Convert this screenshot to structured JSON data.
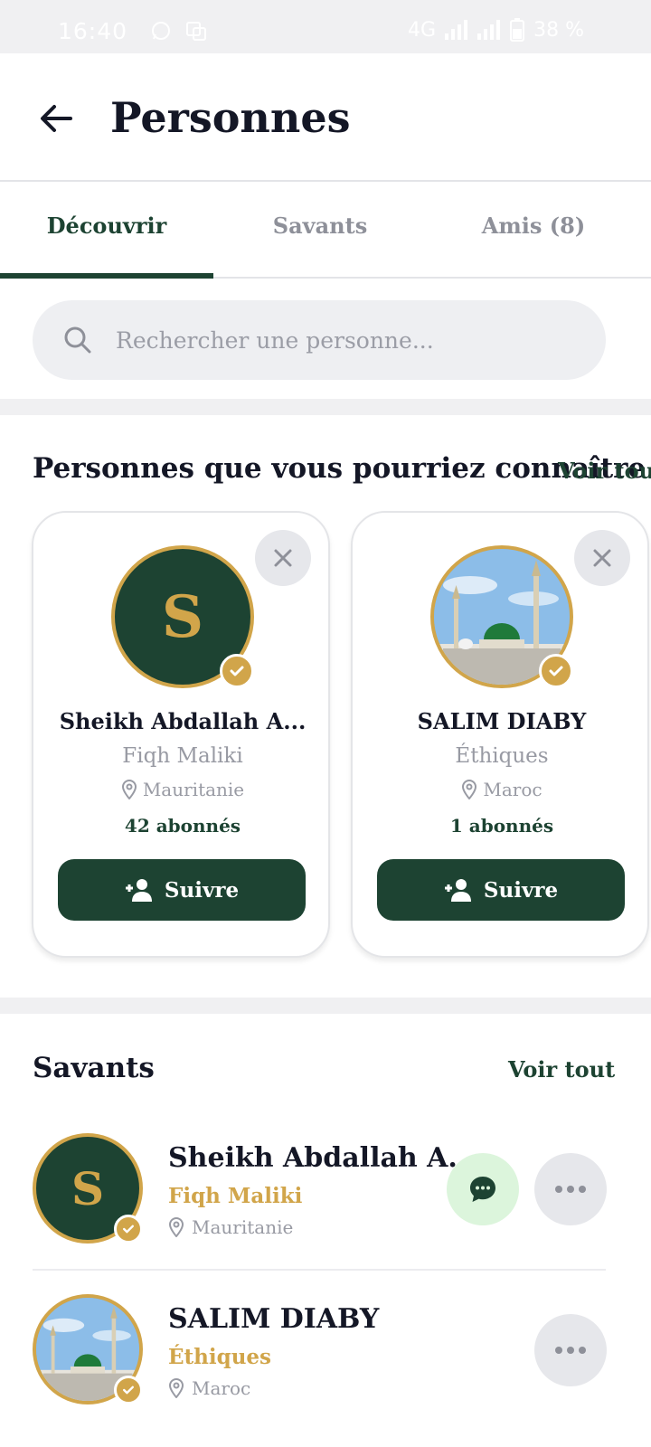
{
  "status_bar": {
    "time": "16:40",
    "network": "4G",
    "battery": "38 %"
  },
  "header": {
    "title": "Personnes"
  },
  "tabs": [
    {
      "label": "Découvrir",
      "active": true
    },
    {
      "label": "Savants",
      "active": false
    },
    {
      "label": "Amis (8)",
      "active": false
    }
  ],
  "search": {
    "placeholder": "Rechercher une personne..."
  },
  "suggestions": {
    "title": "Personnes que vous pourriez connaître",
    "see_all": "Voir tout",
    "cards": [
      {
        "initial": "S",
        "name": "Sheikh Abdallah A...",
        "specialty": "Fiqh Maliki",
        "location": "Mauritanie",
        "followers": "42 abonnés",
        "follow_label": "Suivre",
        "avatar": "letter-avatar"
      },
      {
        "initial": "",
        "name": "SALIM DIABY",
        "specialty": "Éthiques",
        "location": "Maroc",
        "followers": "1 abonnés",
        "follow_label": "Suivre",
        "avatar": "mosque-photo"
      }
    ]
  },
  "scholars": {
    "title": "Savants",
    "see_all": "Voir tout",
    "items": [
      {
        "initial": "S",
        "name": "Sheikh Abdallah A...",
        "specialty": "Fiqh Maliki",
        "location": "Mauritanie",
        "has_message": true,
        "avatar": "letter-avatar"
      },
      {
        "initial": "",
        "name": "SALIM DIABY",
        "specialty": "Éthiques",
        "location": "Maroc",
        "has_message": false,
        "avatar": "mosque-photo"
      }
    ]
  },
  "colors": {
    "primary": "#1d4332",
    "gold": "#d1a54a",
    "message_bg": "#dcf5dc"
  }
}
